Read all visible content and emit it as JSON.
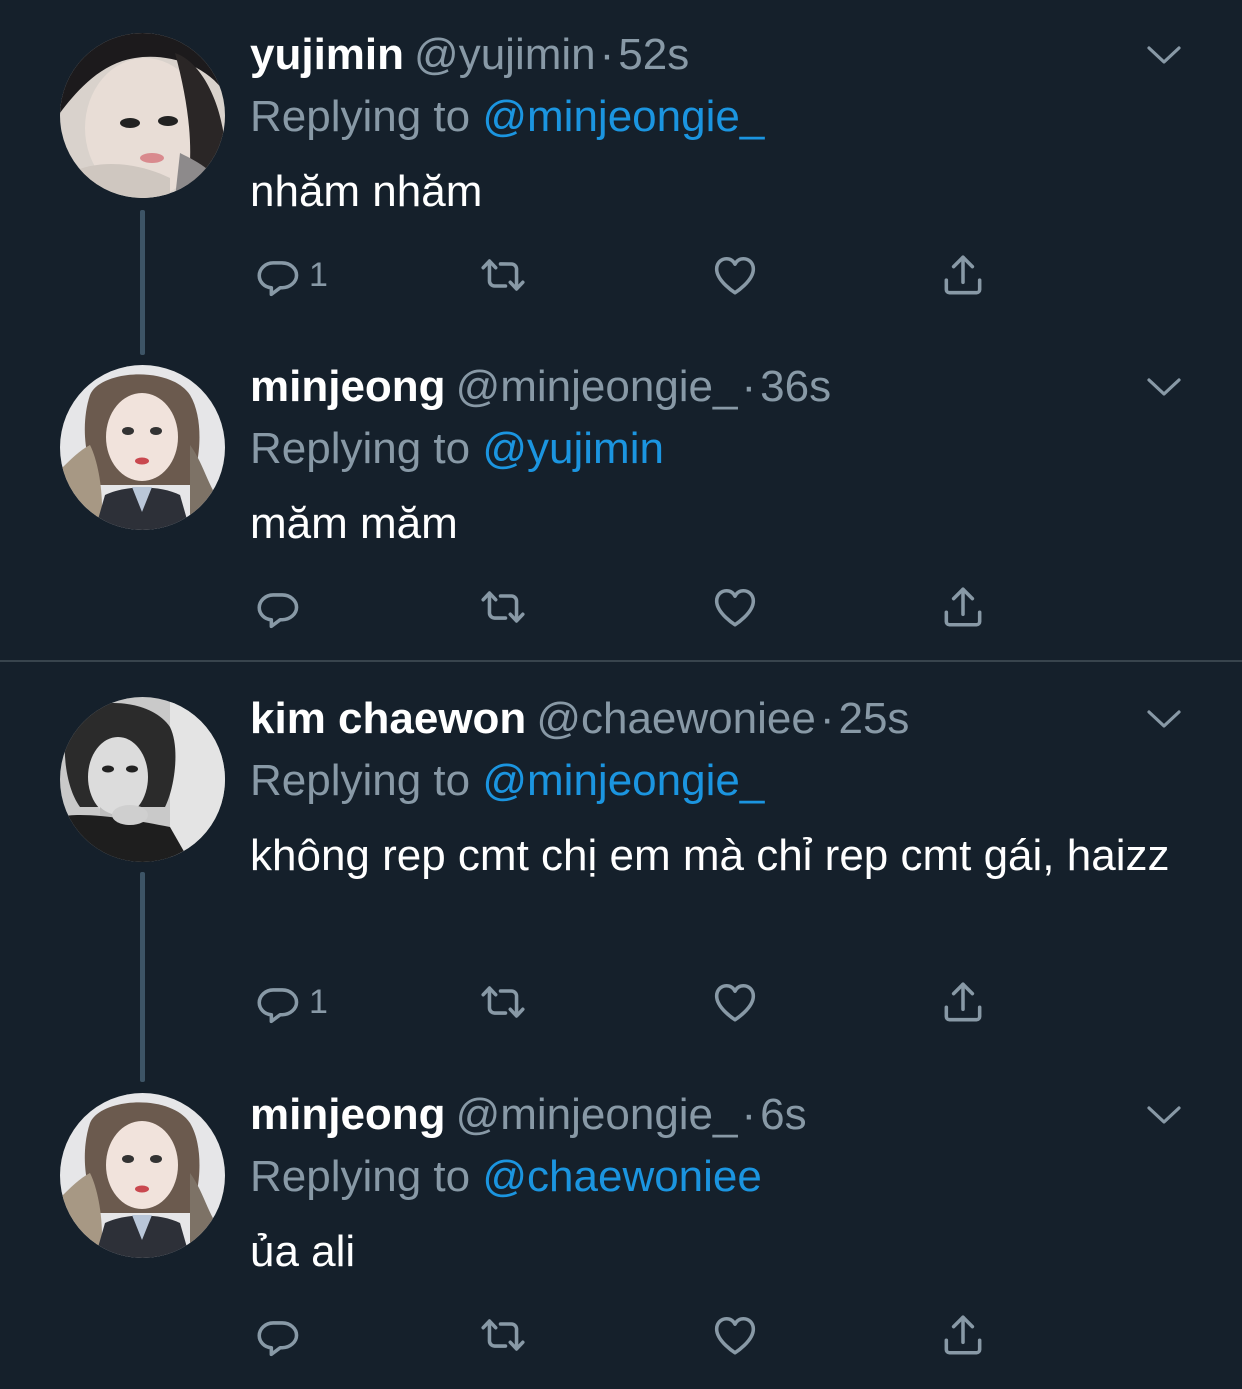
{
  "tweets": [
    {
      "name": "yujimin",
      "handle": "@yujimin",
      "separator": "·",
      "time": "52s",
      "replying_prefix": "Replying to ",
      "replying_to": "@minjeongie_",
      "text": "nhăm nhăm",
      "reply_count": "1",
      "icons": {
        "more": "chevron-down-icon",
        "reply": "reply-icon",
        "retweet": "retweet-icon",
        "like": "heart-icon",
        "share": "share-icon"
      }
    },
    {
      "name": "minjeong",
      "handle": "@minjeongie_",
      "separator": "·",
      "time": "36s",
      "replying_prefix": "Replying to ",
      "replying_to": "@yujimin",
      "text": "măm măm",
      "reply_count": "",
      "icons": {
        "more": "chevron-down-icon",
        "reply": "reply-icon",
        "retweet": "retweet-icon",
        "like": "heart-icon",
        "share": "share-icon"
      }
    },
    {
      "name": "kim chaewon",
      "handle": "@chaewoniee",
      "separator": "·",
      "time": "25s",
      "replying_prefix": "Replying to ",
      "replying_to": "@minjeongie_",
      "text": "không rep cmt chị em mà chỉ rep cmt gái, haizz",
      "reply_count": "1",
      "icons": {
        "more": "chevron-down-icon",
        "reply": "reply-icon",
        "retweet": "retweet-icon",
        "like": "heart-icon",
        "share": "share-icon"
      }
    },
    {
      "name": "minjeong",
      "handle": "@minjeongie_",
      "separator": "·",
      "time": "6s",
      "replying_prefix": "Replying to ",
      "replying_to": "@chaewoniee",
      "text": "ủa ali",
      "reply_count": "",
      "icons": {
        "more": "chevron-down-icon",
        "reply": "reply-icon",
        "retweet": "retweet-icon",
        "like": "heart-icon",
        "share": "share-icon"
      }
    }
  ],
  "colors": {
    "background": "#15202b",
    "secondary_text": "#8899a6",
    "mention": "#1b95e0",
    "thread_line": "#3d5466",
    "separator": "#38444d"
  }
}
